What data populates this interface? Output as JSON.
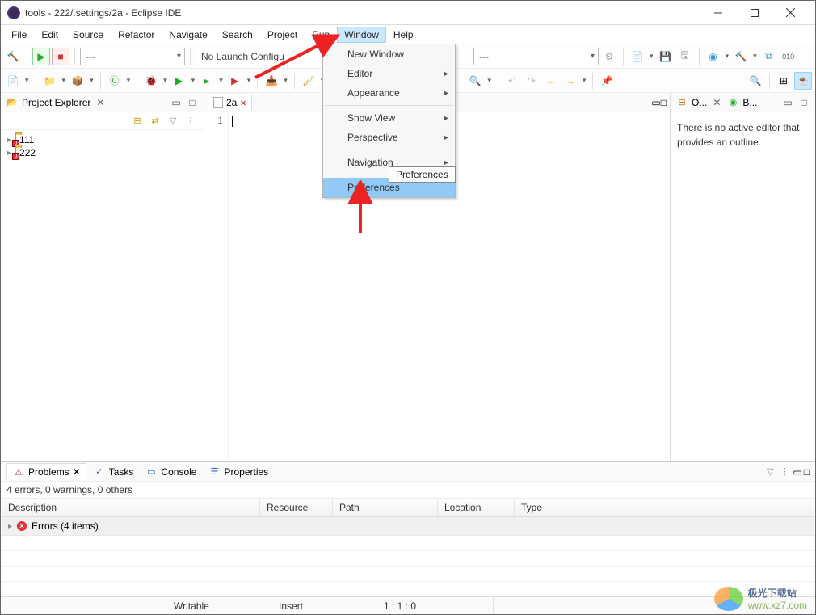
{
  "window": {
    "title": "tools - 222/.settings/2a - Eclipse IDE"
  },
  "menubar": [
    "File",
    "Edit",
    "Source",
    "Refactor",
    "Navigate",
    "Search",
    "Project",
    "Run",
    "Window",
    "Help"
  ],
  "active_menu_index": 8,
  "toolbar": {
    "launch_config": "No Launch Configu",
    "combo_placeholder": "---",
    "combo_placeholder2": "---"
  },
  "dropdown": {
    "items": [
      {
        "label": "New Window",
        "submenu": false
      },
      {
        "label": "Editor",
        "submenu": true
      },
      {
        "label": "Appearance",
        "submenu": true
      },
      {
        "sep": true
      },
      {
        "label": "Show View",
        "submenu": true
      },
      {
        "label": "Perspective",
        "submenu": true
      },
      {
        "sep": true
      },
      {
        "label": "Navigation",
        "submenu": true
      },
      {
        "sep": true
      },
      {
        "label": "Preferences",
        "submenu": false,
        "selected": true
      }
    ],
    "tooltip": "Preferences"
  },
  "project_explorer": {
    "title": "Project Explorer",
    "items": [
      {
        "name": "111"
      },
      {
        "name": "222"
      }
    ]
  },
  "editor": {
    "tab_name": "2a",
    "dirty": true,
    "line_numbers": [
      "1"
    ]
  },
  "outline": {
    "tab1": "O...",
    "tab2": "B...",
    "message": "There is no active editor that provides an outline."
  },
  "problems": {
    "tabs": [
      "Problems",
      "Tasks",
      "Console",
      "Properties"
    ],
    "active_tab": 0,
    "summary": "4 errors, 0 warnings, 0 others",
    "columns": [
      "Description",
      "Resource",
      "Path",
      "Location",
      "Type"
    ],
    "row": {
      "label": "Errors (4 items)"
    }
  },
  "status": {
    "writable": "Writable",
    "insert": "Insert",
    "cursor": "1 : 1 : 0"
  },
  "watermark": {
    "cn": "极光下载站",
    "url": "www.xz7.com"
  }
}
